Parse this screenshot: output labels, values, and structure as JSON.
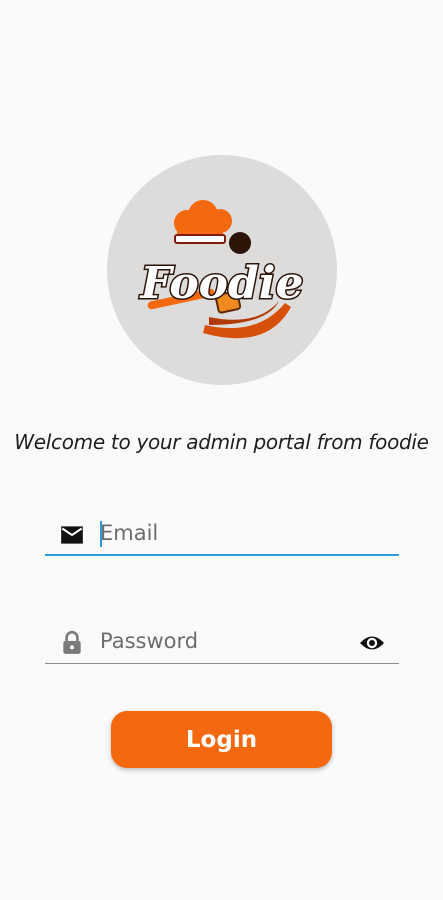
{
  "logo": {
    "text": "Foodie",
    "icon": "chef-hat-pan-logo"
  },
  "welcome_text": "Welcome to your admin portal from foodie",
  "email_field": {
    "icon": "mail-icon",
    "placeholder": "Email",
    "value": ""
  },
  "password_field": {
    "icon": "lock-icon",
    "placeholder": "Password",
    "value": "",
    "toggle_icon": "eye-icon"
  },
  "login_button": {
    "label": "Login"
  },
  "colors": {
    "accent": "#f4690f",
    "focus": "#2f9ad8",
    "background": "#fafafa",
    "logo_circle": "#dedcda"
  }
}
